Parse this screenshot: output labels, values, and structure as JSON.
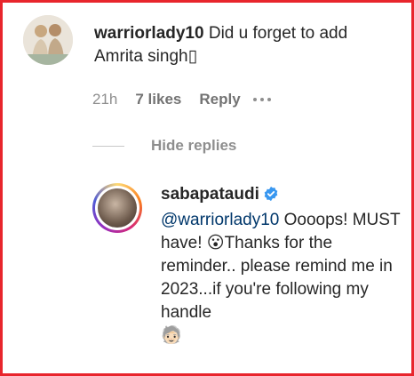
{
  "comment": {
    "username": "warriorlady10",
    "text": " Did u forget to add Amrita singh▯",
    "time": "21h",
    "likes": "7 likes",
    "reply_label": "Reply"
  },
  "hide_replies_label": "Hide replies",
  "reply": {
    "username": "sabapataudi",
    "mention": "@warriorlady10",
    "text": " Oooops! MUST have! 😮Thanks for the reminder.. please remind me in 2023...if you're following my handle",
    "trailing_emoji": "🧓🏻"
  },
  "colors": {
    "frame": "#e8252c",
    "verified": "#3897f0",
    "mention": "#00376b"
  }
}
